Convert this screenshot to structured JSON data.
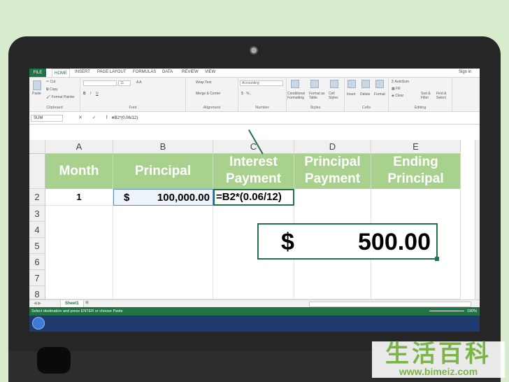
{
  "ribbon_tabs": [
    "FILE",
    "HOME",
    "INSERT",
    "PAGE LAYOUT",
    "FORMULAS",
    "DATA",
    "REVIEW",
    "VIEW"
  ],
  "sign_in": "Sign in",
  "ribbon": {
    "clipboard": {
      "label": "Clipboard",
      "paste": "Paste",
      "cut": "Cut",
      "copy": "Copy",
      "format_painter": "Format Painter"
    },
    "font": {
      "label": "Font",
      "name": "",
      "size": "11"
    },
    "alignment": {
      "label": "Alignment",
      "wrap": "Wrap Text",
      "merge": "Merge & Center"
    },
    "number": {
      "label": "Number",
      "format": "Accounting"
    },
    "styles": {
      "label": "Styles",
      "conditional": "Conditional Formatting",
      "format_table": "Format as Table",
      "cell_styles": "Cell Styles"
    },
    "cells": {
      "label": "Cells",
      "insert": "Insert",
      "delete": "Delete",
      "format": "Format"
    },
    "editing": {
      "label": "Editing",
      "autosum": "AutoSum",
      "fill": "Fill",
      "clear": "Clear",
      "sort": "Sort & Filter",
      "find": "Find & Select"
    }
  },
  "formula_bar": {
    "name_box": "SUM",
    "icons": "✕ ✓ fx",
    "formula": "=B2*(0.06/12)"
  },
  "columns": [
    "A",
    "B",
    "C",
    "D",
    "E"
  ],
  "rows": [
    "2",
    "3",
    "4",
    "5",
    "6",
    "7",
    "8"
  ],
  "headers": [
    {
      "line1": "Month",
      "line2": ""
    },
    {
      "line1": "Principal",
      "line2": ""
    },
    {
      "line1": "Interest",
      "line2": "Payment"
    },
    {
      "line1": "Principal",
      "line2": "Payment"
    },
    {
      "line1": "Ending",
      "line2": "Principal"
    }
  ],
  "row2": {
    "month": "1",
    "currency": "$",
    "principal": "100,000.00",
    "formula": "=B2*(0.06/12)"
  },
  "popout": {
    "currency": "$",
    "value": "500.00"
  },
  "sheet_tab": "Sheet1",
  "status_text": "Select destination and press ENTER or choose Paste",
  "zoom": "190%",
  "watermark": {
    "chinese": "生活百科",
    "url": "www.bimeiz.com"
  }
}
